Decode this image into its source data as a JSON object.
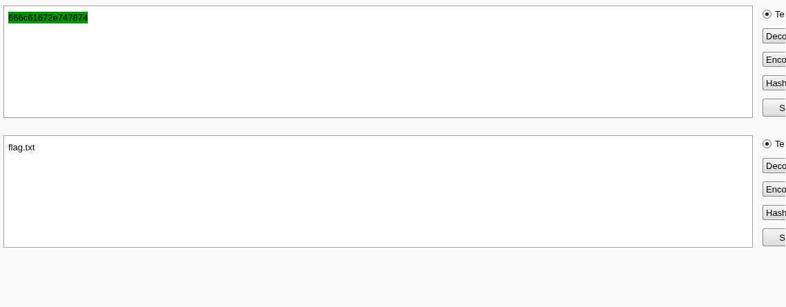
{
  "panels": [
    {
      "text": "666c61672e747874",
      "highlighted": true,
      "radio": {
        "label": "Te",
        "selected": true
      },
      "buttons": [
        {
          "label": "Deco",
          "kind": "left"
        },
        {
          "label": "Enco",
          "kind": "left"
        },
        {
          "label": "Hash",
          "kind": "left"
        },
        {
          "label": "S",
          "kind": "center"
        }
      ]
    },
    {
      "text": "flag.txt",
      "highlighted": false,
      "radio": {
        "label": "Te",
        "selected": true
      },
      "buttons": [
        {
          "label": "Deco",
          "kind": "left"
        },
        {
          "label": "Enco",
          "kind": "left"
        },
        {
          "label": "Hash",
          "kind": "left"
        },
        {
          "label": "S",
          "kind": "center"
        }
      ]
    }
  ]
}
